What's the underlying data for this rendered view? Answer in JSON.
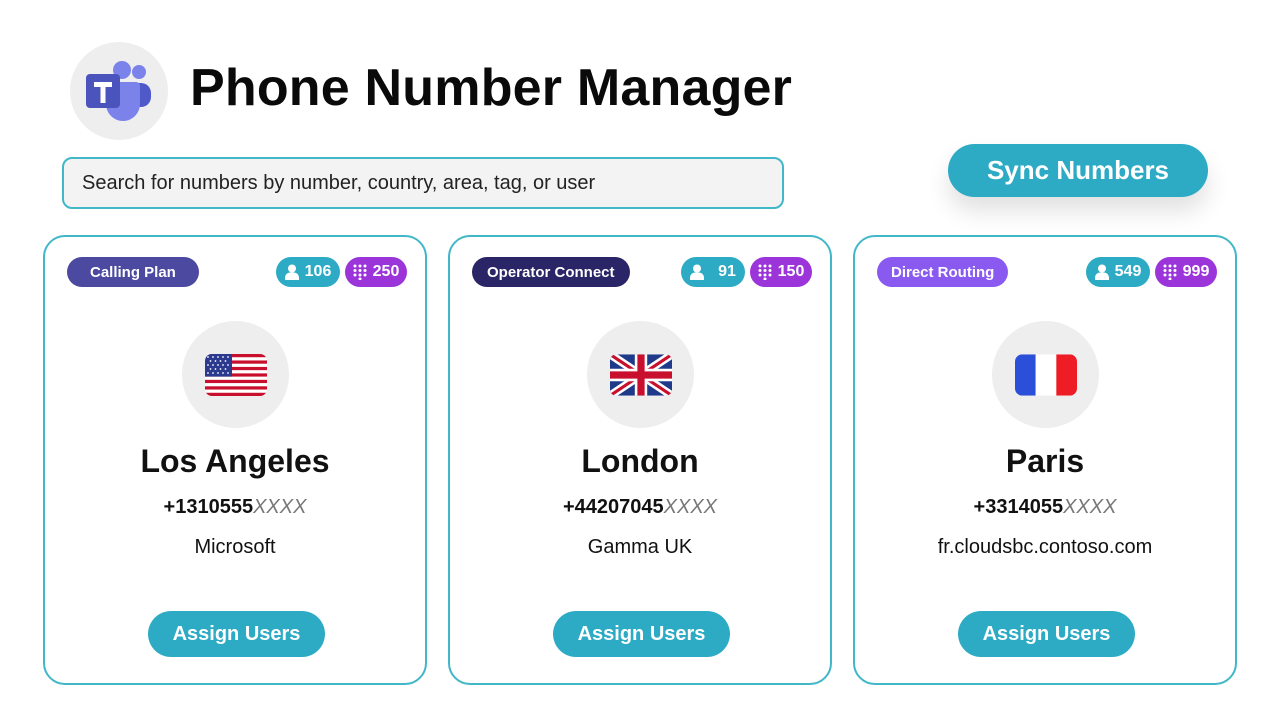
{
  "header": {
    "title": "Phone Number Manager",
    "logo_icon": "teams-logo-icon"
  },
  "search": {
    "placeholder": "Search for numbers by number, country, area, tag, or user"
  },
  "toolbar": {
    "sync_label": "Sync Numbers"
  },
  "colors": {
    "accent": "#2dabc5",
    "numbers_badge": "#9b34d9",
    "calling_plan": "#4b4aa0",
    "operator_connect": "#2a2566",
    "direct_routing": "#8a5af0"
  },
  "cards": [
    {
      "type_label": "Calling Plan",
      "type_color": "#4b4aa0",
      "users": "106",
      "numbers": "250",
      "flag_icon": "us-flag-icon",
      "city": "Los Angeles",
      "number_prefix": "+1310555",
      "number_mask": "XXXX",
      "provider": "Microsoft",
      "assign_label": "Assign Users"
    },
    {
      "type_label": "Operator Connect",
      "type_color": "#2a2566",
      "users": "91",
      "numbers": "150",
      "flag_icon": "uk-flag-icon",
      "city": "London",
      "number_prefix": "+44207045",
      "number_mask": "XXXX",
      "provider": "Gamma UK",
      "assign_label": "Assign Users"
    },
    {
      "type_label": "Direct Routing",
      "type_color": "#8a5af0",
      "users": "549",
      "numbers": "999",
      "flag_icon": "france-flag-icon",
      "city": "Paris",
      "number_prefix": "+3314055",
      "number_mask": "XXXX",
      "provider": "fr.cloudsbc.contoso.com",
      "assign_label": "Assign Users"
    }
  ]
}
